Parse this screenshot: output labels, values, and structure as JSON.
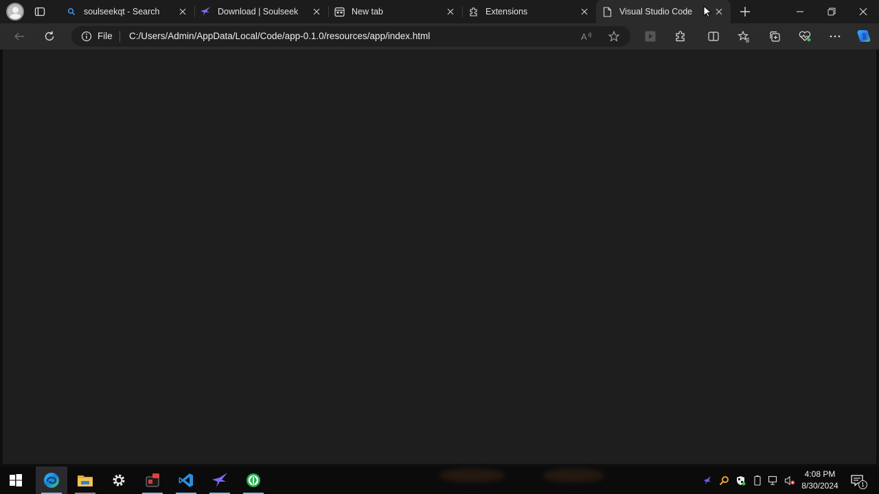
{
  "browser": {
    "tabs": [
      {
        "title": "soulseekqt - Search",
        "icon": "search-icon"
      },
      {
        "title": "Download | Soulseek",
        "icon": "soulseek-bird-icon"
      },
      {
        "title": "New tab",
        "icon": "newtab-icon"
      },
      {
        "title": "Extensions",
        "icon": "extension-icon"
      },
      {
        "title": "Visual Studio Code",
        "icon": "page-icon",
        "active": true
      }
    ],
    "address_bar": {
      "scheme_label": "File",
      "url": "C:/Users/Admin/AppData/Local/Code/app-0.1.0/resources/app/index.html"
    }
  },
  "taskbar": {
    "apps": [
      "start-icon",
      "edge-icon",
      "file-explorer-icon",
      "settings-icon",
      "media-app-icon",
      "vscode-icon",
      "soulseek-icon",
      "green-app-icon"
    ],
    "clock": {
      "time": "4:08 PM",
      "date": "8/30/2024"
    },
    "notifications_count": "1"
  },
  "colors": {
    "accent": "#76b9ed",
    "content_bg": "#1e1e1e",
    "toolbar_bg": "#2b2b2b"
  }
}
